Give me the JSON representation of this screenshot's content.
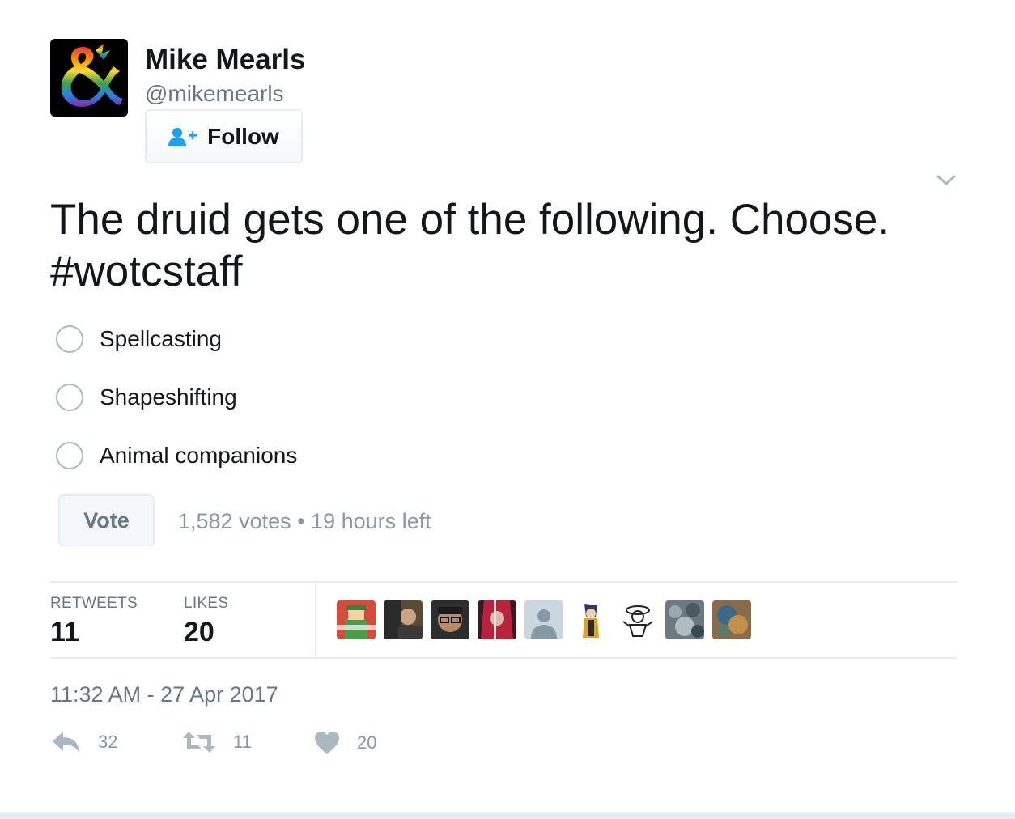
{
  "author": {
    "display_name": "Mike Mearls",
    "handle": "@mikemearls",
    "avatar_icon": "rainbow-ampersand-dragon-logo"
  },
  "follow_button": {
    "label": "Follow",
    "icon": "follow-user-icon"
  },
  "tweet": {
    "text": "The druid gets one of the following. Choose.",
    "hashtag": "#wotcstaff"
  },
  "poll": {
    "options": [
      {
        "label": "Spellcasting"
      },
      {
        "label": "Shapeshifting"
      },
      {
        "label": "Animal companions"
      }
    ],
    "vote_label": "Vote",
    "meta": "1,582 votes • 19 hours left"
  },
  "stats": {
    "retweets_label": "RETWEETS",
    "retweets_value": "11",
    "likes_label": "LIKES",
    "likes_value": "20"
  },
  "timestamp": "11:32 AM - 27 Apr 2017",
  "actions": {
    "reply_count": "32",
    "retweet_count": "11",
    "like_count": "20"
  },
  "colors": {
    "text": "#14171a",
    "secondary": "#657786",
    "muted": "#8899a6",
    "border": "#e6ecf0",
    "follow_icon": "#1da1f2"
  }
}
